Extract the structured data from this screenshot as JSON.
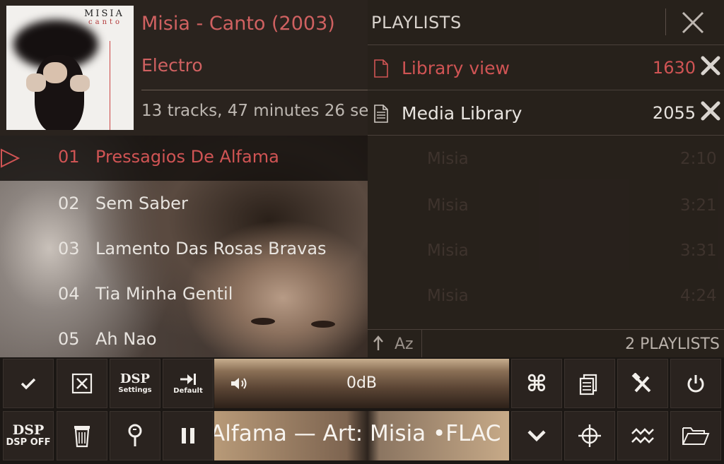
{
  "album": {
    "title": "Misia - Canto (2003)",
    "genre": "Electro",
    "info": "13 tracks, 47 minutes 26 se",
    "art_brand": "MISIA",
    "art_subtitle": "canto"
  },
  "tracks": [
    {
      "num": "01",
      "title": "Pressagios De Alfama",
      "active": true
    },
    {
      "num": "02",
      "title": "Sem Saber"
    },
    {
      "num": "03",
      "title": "Lamento Das Rosas Bravas"
    },
    {
      "num": "04",
      "title": "Tia Minha Gentil"
    },
    {
      "num": "05",
      "title": "Ah Nao"
    }
  ],
  "ghost_rows": [
    {
      "artist": "Misia",
      "duration": "2:10"
    },
    {
      "artist": "Misia",
      "duration": "3:21"
    },
    {
      "artist": "Misia",
      "duration": "3:31"
    },
    {
      "artist": "Misia",
      "duration": "4:24"
    }
  ],
  "playlists_panel": {
    "title": "PLAYLISTS",
    "items": [
      {
        "name": "Library view",
        "count": "1630"
      },
      {
        "name": "Media Library",
        "count": "2055"
      }
    ],
    "sort_label": "Az",
    "count_label": "2 PLAYLISTS"
  },
  "controls": {
    "dsp_label": "DSP",
    "dsp_settings_caption": "Settings",
    "default_caption": "Default",
    "dsp_off_label": "DSP",
    "dsp_off_caption": "DSP OFF",
    "volume": "0dB",
    "ticker": "Alfama — Art: Misia •FLAC"
  },
  "colors": {
    "accent": "#d05454",
    "panel": "#28211c"
  }
}
